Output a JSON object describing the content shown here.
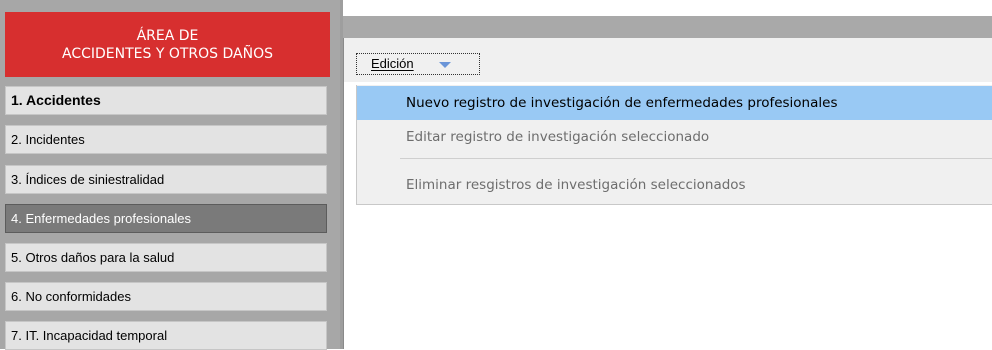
{
  "sidebar": {
    "header_line1": "ÁREA DE",
    "header_line2": "ACCIDENTES Y OTROS DAÑOS",
    "items": [
      {
        "label": "1. Accidentes"
      },
      {
        "label": "2. Incidentes"
      },
      {
        "label": "3. Índices de siniestralidad"
      },
      {
        "label": "4. Enfermedades profesionales"
      },
      {
        "label": "5. Otros daños para la salud"
      },
      {
        "label": "6. No conformidades"
      },
      {
        "label": "7. IT. Incapacidad temporal"
      }
    ],
    "selected_item": "4. Enfermedades profesionales",
    "colors": {
      "header": "#d72f2f",
      "selected": "#7a7a7a",
      "item": "#e3e3e3"
    }
  },
  "toolbar": {
    "edit_label": "Edición",
    "edit_icon": "chevron-down-icon"
  },
  "menu": {
    "items": [
      {
        "label": "Nuevo registro de investigación de enfermedades profesionales",
        "state": "highlighted"
      },
      {
        "label": "Editar registro de investigación seleccionado",
        "state": "disabled"
      },
      {
        "label": "Eliminar resgistros de investigación seleccionados",
        "state": "disabled"
      }
    ],
    "highlight_color": "#99c9f4"
  }
}
